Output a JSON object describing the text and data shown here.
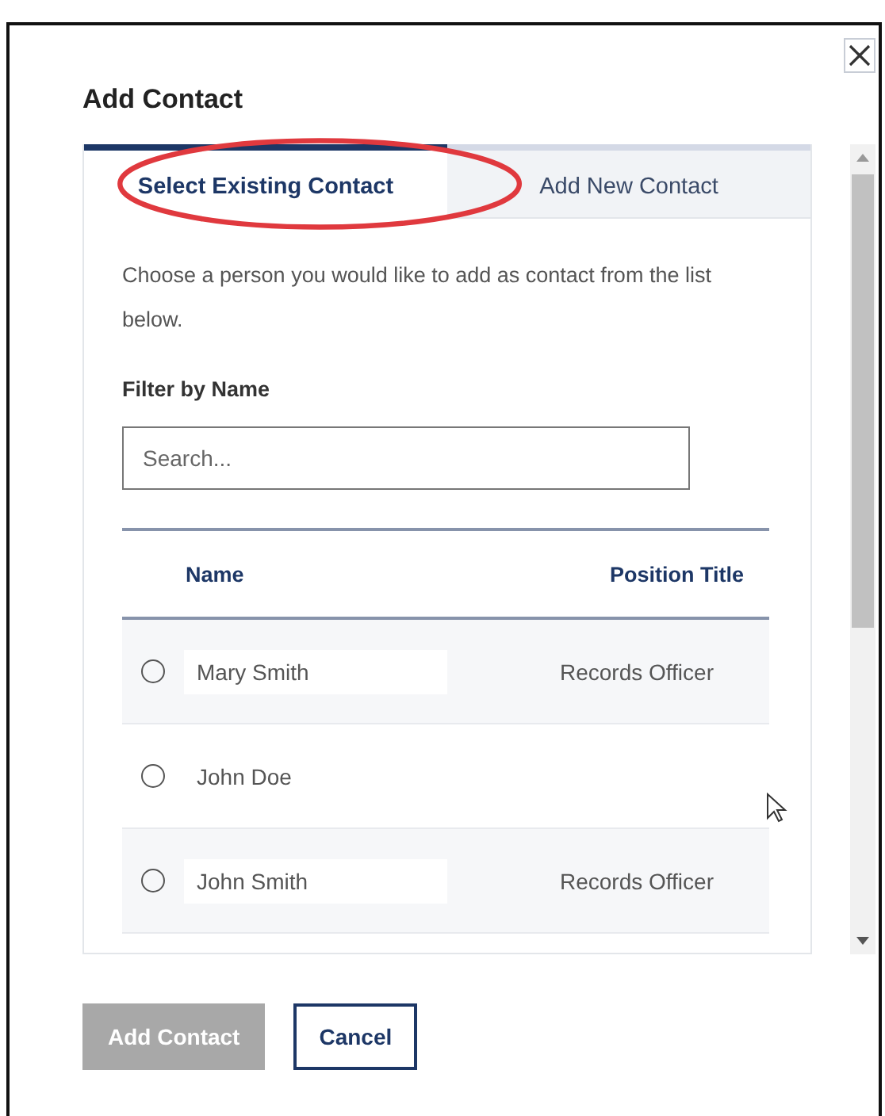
{
  "dialog": {
    "title": "Add Contact"
  },
  "tabs": [
    {
      "label": "Select Existing Contact",
      "selected": true
    },
    {
      "label": "Add New Contact",
      "selected": false
    }
  ],
  "intro": "Choose a person you would like to add as contact from the list below.",
  "filter": {
    "label": "Filter by Name",
    "placeholder": "Search..."
  },
  "table": {
    "columns": [
      "Name",
      "Position Title"
    ],
    "rows": [
      {
        "name": "Mary Smith",
        "position": "Records Officer",
        "selected": false
      },
      {
        "name": "John Doe",
        "position": "",
        "selected": false
      },
      {
        "name": "John Smith",
        "position": "Records Officer",
        "selected": false
      }
    ]
  },
  "buttons": [
    {
      "label": "Add Contact",
      "kind": "primary",
      "disabled": true
    },
    {
      "label": "Cancel",
      "kind": "secondary",
      "disabled": false
    }
  ]
}
